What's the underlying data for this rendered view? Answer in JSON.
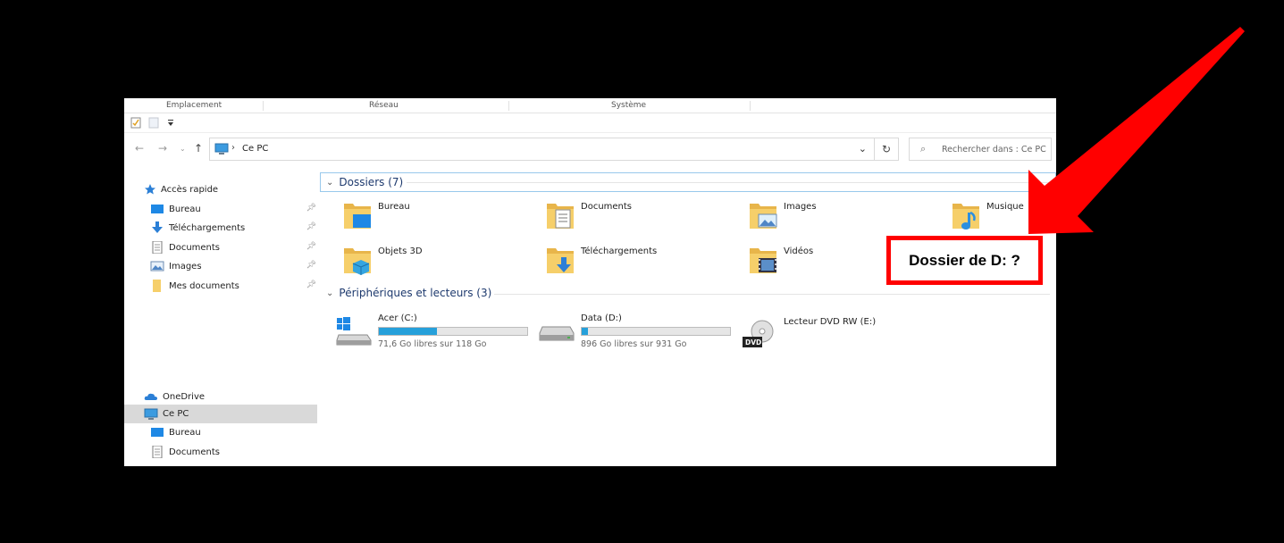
{
  "ribbon": {
    "groups": [
      "Emplacement",
      "Réseau",
      "Système"
    ]
  },
  "address": {
    "path": "Ce PC",
    "search_placeholder": "Rechercher dans : Ce PC"
  },
  "sidebar": {
    "quick_access": "Accès rapide",
    "quick_items": [
      "Bureau",
      "Téléchargements",
      "Documents",
      "Images",
      "Mes documents"
    ],
    "onedrive": "OneDrive",
    "this_pc": "Ce PC",
    "this_pc_items": [
      "Bureau",
      "Documents"
    ]
  },
  "content": {
    "folders_header": "Dossiers (7)",
    "folders": [
      "Bureau",
      "Documents",
      "Images",
      "Musique",
      "Objets 3D",
      "Téléchargements",
      "Vidéos"
    ],
    "devices_header": "Périphériques et lecteurs (3)",
    "drives": [
      {
        "name": "Acer (C:)",
        "free": "71,6 Go libres sur 118 Go",
        "used_fraction": 0.39
      },
      {
        "name": "Data (D:)",
        "free": "896 Go libres sur 931 Go",
        "used_fraction": 0.04
      },
      {
        "name": "Lecteur DVD RW (E:)"
      }
    ],
    "dvd_badge": "DVD"
  },
  "annotation": {
    "text": "Dossier de D: ?",
    "color": "#ff0000"
  },
  "colors": {
    "drive_bar": "#26a0da",
    "folder": "#f6cf6a",
    "accent_blue": "#1e88e5"
  }
}
